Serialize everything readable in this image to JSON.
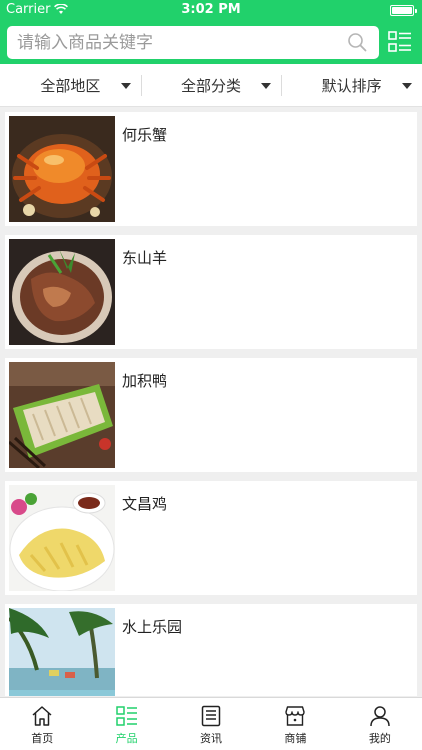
{
  "status_bar": {
    "carrier": "Carrier",
    "time": "3:02 PM"
  },
  "search": {
    "placeholder": "请输入商品关键字"
  },
  "filters": [
    {
      "label": "全部地区"
    },
    {
      "label": "全部分类"
    },
    {
      "label": "默认排序"
    }
  ],
  "items": [
    {
      "title": "何乐蟹",
      "icon": "crab-dish-photo"
    },
    {
      "title": "东山羊",
      "icon": "goat-meat-photo"
    },
    {
      "title": "加积鸭",
      "icon": "duck-dish-photo"
    },
    {
      "title": "文昌鸡",
      "icon": "chicken-dish-photo"
    },
    {
      "title": "水上乐园",
      "icon": "water-park-photo"
    }
  ],
  "tabs": [
    {
      "label": "首页",
      "icon": "home-icon"
    },
    {
      "label": "产品",
      "icon": "products-icon",
      "active": true
    },
    {
      "label": "资讯",
      "icon": "news-icon"
    },
    {
      "label": "商铺",
      "icon": "store-icon"
    },
    {
      "label": "我的",
      "icon": "profile-icon"
    }
  ],
  "colors": {
    "accent": "#21d16b",
    "background": "#efefef"
  }
}
